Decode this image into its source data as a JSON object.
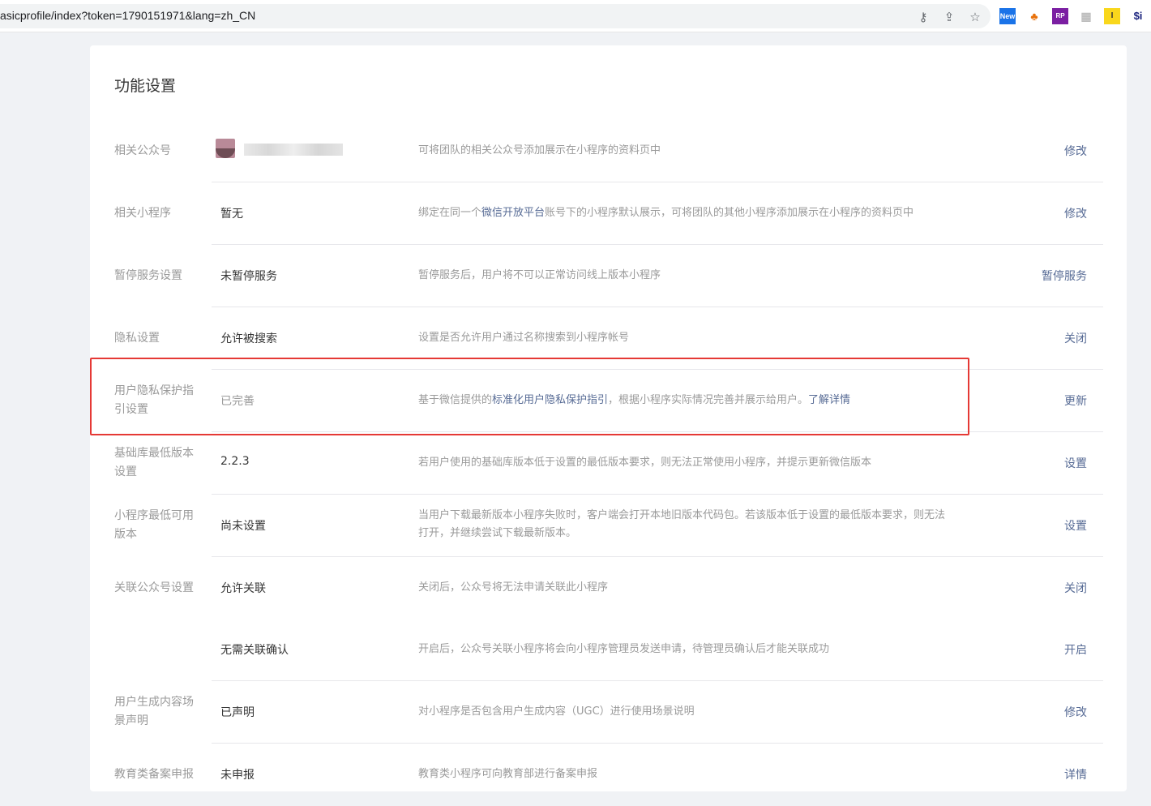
{
  "browser": {
    "url": "asicprofile/index?token=1790151971&lang=zh_CN",
    "extensions": [
      "New",
      "RP",
      "I",
      "$i"
    ]
  },
  "page": {
    "title": "功能设置",
    "rows": [
      {
        "label": "相关公众号",
        "value": "",
        "desc_parts": [
          "可将团队的相关公众号添加展示在小程序的资料页中"
        ],
        "action": "修改"
      },
      {
        "label": "相关小程序",
        "value": "暂无",
        "desc_parts": [
          "绑定在同一个",
          "微信开放平台",
          "账号下的小程序默认展示，可将团队的其他小程序添加展示在小程序的资料页中"
        ],
        "action": "修改"
      },
      {
        "label": "暂停服务设置",
        "value": "未暂停服务",
        "desc_parts": [
          "暂停服务后，用户将不可以正常访问线上版本小程序"
        ],
        "action": "暂停服务"
      },
      {
        "label": "隐私设置",
        "value": "允许被搜索",
        "desc_parts": [
          "设置是否允许用户通过名称搜索到小程序帐号"
        ],
        "action": "关闭"
      },
      {
        "label_l1": "用户隐私保护指",
        "label_l2": "引设置",
        "value": "已完善",
        "desc_parts": [
          "基于微信提供的",
          "标准化用户隐私保护指引",
          "，根据小程序实际情况完善并展示给用户。",
          "了解详情"
        ],
        "action": "更新"
      },
      {
        "label_l1": "基础库最低版本",
        "label_l2": "设置",
        "value": "2.2.3",
        "desc_parts": [
          "若用户使用的基础库版本低于设置的最低版本要求，则无法正常使用小程序，并提示更新微信版本"
        ],
        "action": "设置"
      },
      {
        "label_l1": "小程序最低可用",
        "label_l2": "版本",
        "value": "尚未设置",
        "desc_l1": "当用户下载最新版本小程序失败时，客户端会打开本地旧版本代码包。若该版本低于设置的最低版本要求，则无法",
        "desc_l2": "打开，并继续尝试下载最新版本。",
        "action": "设置"
      },
      {
        "label": "关联公众号设置",
        "value": "允许关联",
        "desc_parts": [
          "关闭后，公众号将无法申请关联此小程序"
        ],
        "action": "关闭"
      },
      {
        "label": "",
        "value": "无需关联确认",
        "desc_parts": [
          "开启后，公众号关联小程序将会向小程序管理员发送申请，待管理员确认后才能关联成功"
        ],
        "action": "开启"
      },
      {
        "label_l1": "用户生成内容场",
        "label_l2": "景声明",
        "value": "已声明",
        "desc_parts": [
          "对小程序是否包含用户生成内容（UGC）进行使用场景说明"
        ],
        "action": "修改"
      },
      {
        "label": "教育类备案申报",
        "value": "未申报",
        "desc_parts": [
          "教育类小程序可向教育部进行备案申报"
        ],
        "action": "详情"
      }
    ]
  }
}
